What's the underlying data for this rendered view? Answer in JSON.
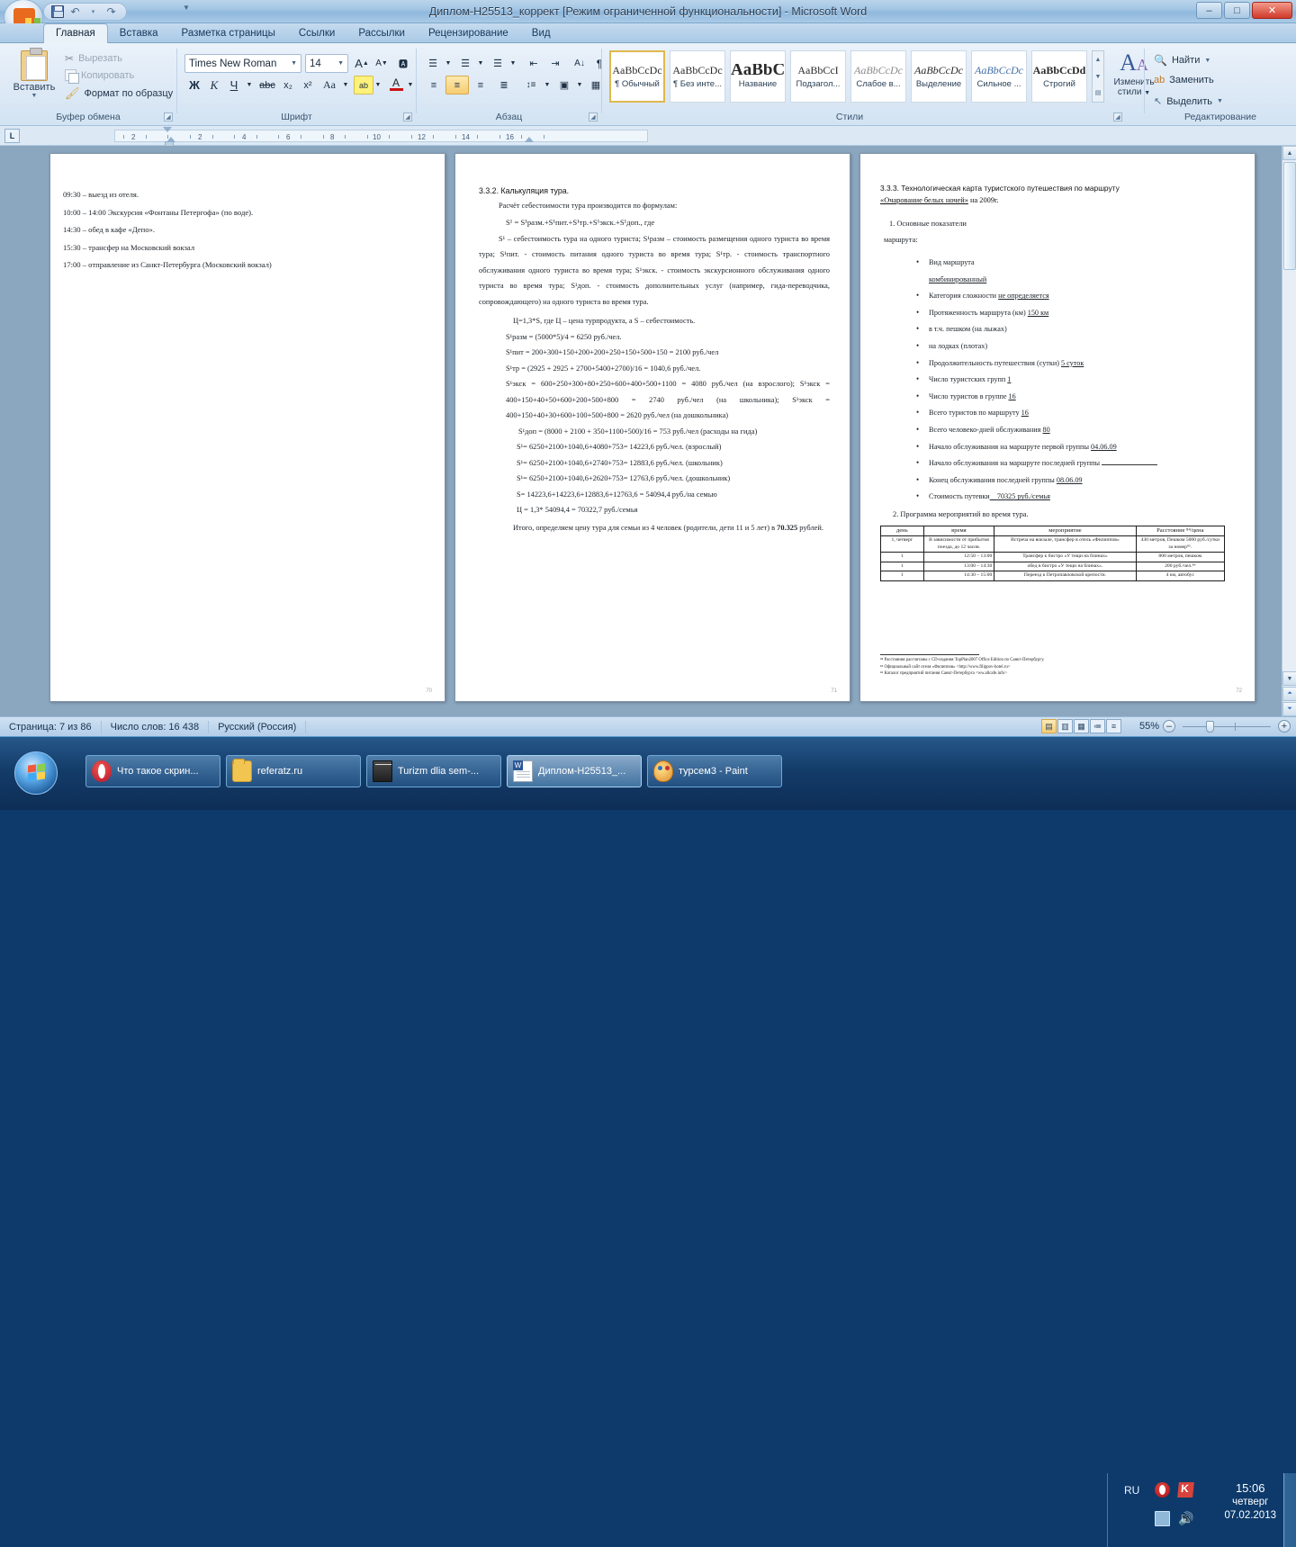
{
  "window": {
    "title": "Диплом-H25513_коррект [Режим ограниченной функциональности] - Microsoft Word",
    "minimize": "–",
    "maximize": "□",
    "close": "✕",
    "office_button": "office-button",
    "quick_access": [
      "save-icon",
      "undo-icon",
      "redo-icon",
      "customize-icon"
    ]
  },
  "tabs": [
    {
      "label": "Главная",
      "active": true
    },
    {
      "label": "Вставка",
      "active": false
    },
    {
      "label": "Разметка страницы",
      "active": false
    },
    {
      "label": "Ссылки",
      "active": false
    },
    {
      "label": "Рассылки",
      "active": false
    },
    {
      "label": "Рецензирование",
      "active": false
    },
    {
      "label": "Вид",
      "active": false
    }
  ],
  "ribbon": {
    "groups": [
      {
        "name": "Буфер обмена"
      },
      {
        "name": "Шрифт"
      },
      {
        "name": "Абзац"
      },
      {
        "name": "Стили"
      },
      {
        "name": "Редактирование"
      }
    ],
    "clipboard": {
      "paste": "Вставить",
      "cut": "Вырезать",
      "copy": "Копировать",
      "format_painter": "Формат по образцу"
    },
    "font": {
      "family": "Times New Roman",
      "size": "14",
      "grow": "A",
      "shrink": "A",
      "clear": "Aa",
      "bold": "Ж",
      "italic": "К",
      "underline": "Ч",
      "strike": "abc",
      "subscript": "x₂",
      "superscript": "x²",
      "change_case": "Aa",
      "highlight": "ab",
      "color": "A"
    },
    "paragraph": {
      "bullets": "bullets-icon",
      "numbering": "numbering-icon",
      "multilevel": "multilevel-icon",
      "dec_indent": "decrease-indent-icon",
      "inc_indent": "increase-indent-icon",
      "sort": "sort-icon",
      "marks": "¶",
      "align_left": "align-left-icon",
      "align_center": "align-center-icon",
      "align_right": "align-right-icon",
      "justify": "justify-icon",
      "line_spacing": "line-spacing-icon",
      "shading": "shading-icon",
      "borders": "borders-icon"
    },
    "styles": [
      {
        "preview": "AaBbCcDc",
        "name": "¶ Обычный",
        "selected": true
      },
      {
        "preview": "AaBbCcDc",
        "name": "¶ Без инте...",
        "selected": false
      },
      {
        "preview": "AaBbC",
        "name": "Название",
        "selected": false
      },
      {
        "preview": "AaBbCcI",
        "name": "Подзагол...",
        "selected": false
      },
      {
        "preview": "AaBbCcDc",
        "name": "Слабое в...",
        "selected": false
      },
      {
        "preview": "AaBbCcDc",
        "name": "Выделение",
        "selected": false
      },
      {
        "preview": "AaBbCcDc",
        "name": "Сильное ...",
        "selected": false
      },
      {
        "preview": "AaBbCcDd",
        "name": "Строгий",
        "selected": false
      }
    ],
    "change_styles": {
      "line1": "Изменить",
      "line2": "стили"
    },
    "editing": {
      "find": "Найти",
      "replace": "Заменить",
      "select": "Выделить"
    }
  },
  "ruler": {
    "tab_selector": "L",
    "ticks": [
      "2",
      "2",
      "4",
      "6",
      "8",
      "10",
      "12",
      "14",
      "16"
    ]
  },
  "document": {
    "page1": {
      "number": "70",
      "lines": [
        "09:30 – выезд из отеля.",
        "10:00 – 14:00 Экскурсия «Фонтаны Петергофа»  (по воде).",
        "14:30 – обед в кафе «Депо».",
        "15:30 – трансфер на Московский вокзал",
        "17:00 – отправление  из Санкт-Петербурга  (Московский вокзал)"
      ]
    },
    "page2": {
      "number": "71",
      "heading": "3.3.2. Калькуляция тура.",
      "intro": "Расчёт себестоимости  тура производится  по формулам:",
      "formula_main": "S¹ = S¹разм.+S¹пит.+S¹тр.+S¹экск.+S¹доп., где",
      "definition": "S¹ – себестоимость тура на одного туриста; S¹разм – стоимость размещения одного туриста во время тура; S¹пит. - стоимость питания одного туриста во время тура; S¹тр. - стоимость транспортного обслуживания одного туриста во время тура; S¹экск. - стоимость экскурсионного обслуживания одного туриста во время тура; S¹доп. - стоимость дополнительных услуг (например, гида-переводчика, сопровождающего) на одного туриста во время тура.",
      "price_rule": "Ц=1,3*S, где Ц – цена турпродукта,  а S – себестоимость.",
      "calc1": "S¹разм = (5000*5)/4 = 6250  руб./чел.",
      "calc2": "S¹пит = 200+300+150+200+200+250+150+500+150 = 2100 руб./чел",
      "calc3": "S¹тр = (2925 + 2925 + 2700+5400+2700)/16  = 1040,6 руб./чел.",
      "calc4": "S¹экск = 600+250+300+80+250+600+400+500+1100 = 4080 руб./чел (на взрослого); S¹экск = 400+150+40+50+600+200+500+800 = 2740 руб./чел (на школьника); S¹экск = 400+150+40+30+600+100+500+800 =  2620 руб./чел (на дошкольника)",
      "calc5": "S¹доп = (8000 + 2100 + 350+1100+500)/16 =  753  руб./чел (расходы на гида)",
      "calc6": "S¹= 6250+2100+1040,6+4080+753= 14223,6 руб./чел. (взрослый)",
      "calc7": "S¹= 6250+2100+1040,6+2740+753= 12883,6 руб./чел. (школьник)",
      "calc8": "S¹= 6250+2100+1040,6+2620+753= 12763,6 руб./чел. (дошкольник)",
      "calc9": "S= 14223,6+14223,6+12883,6+12763,6 =  54094,4 руб./на семью",
      "calc10": "Ц = 1,3* 54094,4 = 70322,7 руб./семья",
      "conclusion_a": "Итого,  определяем  цену тура для семьи из 4 человек   (родители, дети 11 и 5 лет) в ",
      "conclusion_b": "70.325",
      "conclusion_c": " рублей."
    },
    "page3": {
      "number": "72",
      "heading_l1": "3.3.3. Технологическая карта туристского путешествия по маршруту",
      "heading_l2a": "«Очарование  белых  ночей»",
      "heading_l2b": "  на 2009г.",
      "section1_a": "1. Основные показатели",
      "section1_b": "маршрута:",
      "bullets": [
        {
          "text": "Вид маршрута",
          "value": "",
          "extra_line": "комбинированный"
        },
        {
          "text": "Категория сложности ",
          "value": "не определяется"
        },
        {
          "text": "Протяженность  маршрута (км) ",
          "value": "150 км"
        },
        {
          "text": "в т.ч. пешком (на лыжах)",
          "value": ""
        },
        {
          "text": "на лодках (плотах)",
          "value": ""
        },
        {
          "text": "Продолжительность  путешествия  (сутки) ",
          "value": "5 суток"
        },
        {
          "text": "Число туристских  групп ",
          "value": "1"
        },
        {
          "text": "Число туристов  в группе  ",
          "value": "16"
        },
        {
          "text": "Всего туристов  по маршруту  ",
          "value": "16"
        },
        {
          "text": "Всего человеко-дней  обслуживания   ",
          "value": "80"
        },
        {
          "text": "Начало обслуживания  на маршруте  первой группы ",
          "value": "04.06.09"
        },
        {
          "text": "Начало обслуживания  на маршруте  последней  группы  ",
          "value": "__blank__"
        },
        {
          "text": "Конец обслуживания  последней группы ",
          "value": "08.06.09"
        },
        {
          "text": "Стоимость путевки",
          "value": "70325  руб./семья"
        }
      ],
      "section2": "2. Программа мероприятий  во время тура.",
      "table": {
        "headers": [
          "день",
          "время",
          "мероприятие",
          "Расстояние ⁸⁴/цена"
        ],
        "rows": [
          [
            "1, четверг",
            "В зависимости от прибытия поезда, до 12 часов.",
            "Встреча на вокзале, трансфер в отель «Филиппов»",
            "430 метров, Пешком   5000 руб./сутки за номер⁸⁵."
          ],
          [
            "1",
            "12:50 – 13:00",
            "Трансфер к бистро «У тещи на блинах»",
            "800 метров, пешком"
          ],
          [
            "1",
            "13:00 – 14:30",
            "обед в бистро «У тещи на блинах».",
            "200 руб./чел.⁸⁶"
          ],
          [
            "1",
            "14:30 – 15:00",
            "Переезд к Петропавловской крепости.",
            "4 км, автобус"
          ]
        ]
      },
      "footnotes": [
        "⁸⁴ Расстояния рассчитаны с CD-издания TopPlan2007 Office Edition по Санкт-Петербургу.",
        "⁸⁵ Официальный сайт отеля «Филиппов» <http://www.filippov-hotel.ru>",
        "⁸⁶ Каталог предприятий питания Санкт-Петербурга <ww.allcafe.info>"
      ]
    }
  },
  "statusbar": {
    "page": "Страница: 7 из 86",
    "words": "Число слов: 16 438",
    "language": "Русский (Россия)",
    "zoom": "55%",
    "views": [
      "print-layout-icon",
      "full-screen-reading-icon",
      "web-layout-icon",
      "outline-icon",
      "draft-icon"
    ],
    "zoom_out": "–",
    "zoom_in": "+"
  },
  "taskbar": {
    "start": "start-orb",
    "items": [
      {
        "label": "Что такое скрин...",
        "icon": "opera-icon",
        "active": false
      },
      {
        "label": "referatz.ru",
        "icon": "folder-icon",
        "active": false
      },
      {
        "label": "Turizm dlia sem-...",
        "icon": "archive-icon",
        "active": false
      },
      {
        "label": "Диплом-H25513_...",
        "icon": "word-doc-icon",
        "active": true
      },
      {
        "label": "турсем3 - Paint",
        "icon": "paint-icon",
        "active": false
      }
    ],
    "tray": {
      "language": "RU",
      "icons": [
        "opera-tray-icon",
        "kaspersky-tray-icon",
        "network-tray-icon",
        "volume-tray-icon"
      ],
      "time": "15:06",
      "weekday": "четверг",
      "date": "07.02.2013"
    }
  }
}
